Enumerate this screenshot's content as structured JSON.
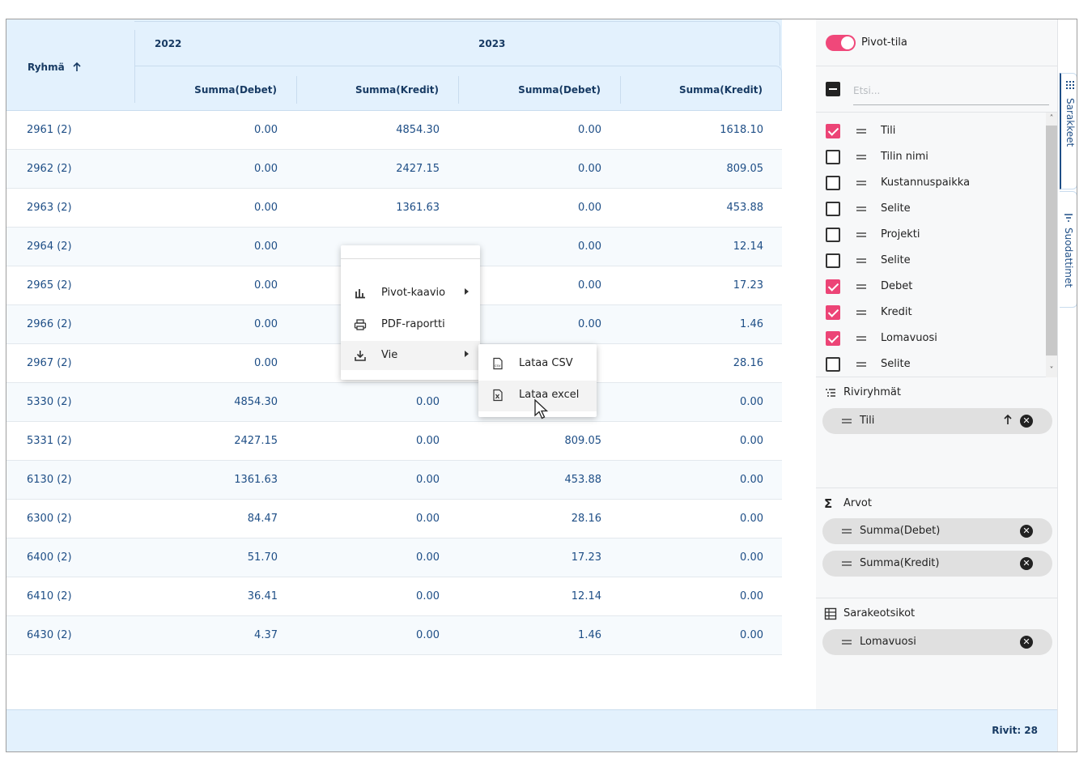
{
  "header": {
    "group_col": "Ryhmä",
    "years": [
      "2022",
      "2023"
    ],
    "value_cols": [
      "Summa(Debet)",
      "Summa(Kredit)",
      "Summa(Debet)",
      "Summa(Kredit)"
    ]
  },
  "rows": [
    {
      "group": "2961 (2)",
      "values": [
        "0.00",
        "4854.30",
        "0.00",
        "1618.10"
      ]
    },
    {
      "group": "2962 (2)",
      "values": [
        "0.00",
        "2427.15",
        "0.00",
        "809.05"
      ]
    },
    {
      "group": "2963 (2)",
      "values": [
        "0.00",
        "1361.63",
        "0.00",
        "453.88"
      ]
    },
    {
      "group": "2964 (2)",
      "values": [
        "0.00",
        "",
        "0.00",
        "12.14"
      ]
    },
    {
      "group": "2965 (2)",
      "values": [
        "0.00",
        "",
        "0.00",
        "17.23"
      ]
    },
    {
      "group": "2966 (2)",
      "values": [
        "0.00",
        "",
        "0.00",
        "1.46"
      ]
    },
    {
      "group": "2967 (2)",
      "values": [
        "0.00",
        "",
        "",
        "28.16"
      ]
    },
    {
      "group": "5330 (2)",
      "values": [
        "4854.30",
        "0.00",
        "",
        "0.00"
      ]
    },
    {
      "group": "5331 (2)",
      "values": [
        "2427.15",
        "0.00",
        "809.05",
        "0.00"
      ]
    },
    {
      "group": "6130 (2)",
      "values": [
        "1361.63",
        "0.00",
        "453.88",
        "0.00"
      ]
    },
    {
      "group": "6300 (2)",
      "values": [
        "84.47",
        "0.00",
        "28.16",
        "0.00"
      ]
    },
    {
      "group": "6400 (2)",
      "values": [
        "51.70",
        "0.00",
        "17.23",
        "0.00"
      ]
    },
    {
      "group": "6410 (2)",
      "values": [
        "36.41",
        "0.00",
        "12.14",
        "0.00"
      ]
    },
    {
      "group": "6430 (2)",
      "values": [
        "4.37",
        "0.00",
        "1.46",
        "0.00"
      ]
    }
  ],
  "status": {
    "rows_label": "Rivit: 28"
  },
  "panel": {
    "pivot_label": "Pivot-tila",
    "pivot_on": true,
    "search_placeholder": "Etsi...",
    "columns": [
      {
        "label": "Tili",
        "checked": true
      },
      {
        "label": "Tilin nimi",
        "checked": false
      },
      {
        "label": "Kustannuspaikka",
        "checked": false
      },
      {
        "label": "Selite",
        "checked": false
      },
      {
        "label": "Projekti",
        "checked": false
      },
      {
        "label": "Selite",
        "checked": false
      },
      {
        "label": "Debet",
        "checked": true
      },
      {
        "label": "Kredit",
        "checked": true
      },
      {
        "label": "Lomavuosi",
        "checked": true
      },
      {
        "label": "Selite",
        "checked": false
      }
    ],
    "row_groups": {
      "title": "Riviryhmät",
      "items": [
        "Tili"
      ]
    },
    "values": {
      "title": "Arvot",
      "items": [
        "Summa(Debet)",
        "Summa(Kredit)"
      ]
    },
    "column_labels": {
      "title": "Sarakeotsikot",
      "items": [
        "Lomavuosi"
      ]
    }
  },
  "side_tabs": [
    "Sarakkeet",
    "Suodattimet"
  ],
  "context_menu": {
    "items": [
      "Pivot-kaavio",
      "PDF-raportti",
      "Vie"
    ],
    "submenu": [
      "Lataa CSV",
      "Lataa excel"
    ]
  },
  "colors": {
    "accent": "#ec4476",
    "header_bg": "#e3f1fd",
    "link_text": "#1e4e86"
  }
}
